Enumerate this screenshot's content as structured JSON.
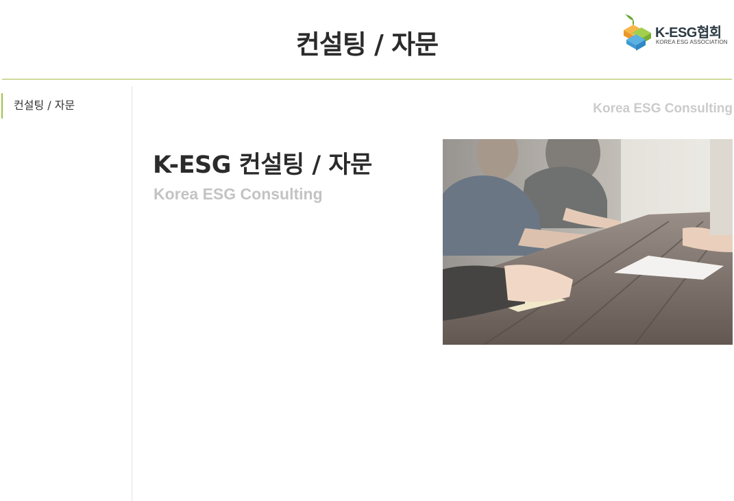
{
  "header": {
    "title": "컨설팅 / 자문",
    "logo": {
      "name": "K-ESG협회",
      "subtitle": "KOREA ESG ASSOCIATION",
      "colors": {
        "orange": "#f0a43a",
        "green": "#8cbf3f",
        "blue": "#3a9bd6",
        "leaf": "#6aa832"
      }
    },
    "accent_line_color": "#a2bb43"
  },
  "sidebar": {
    "items": [
      {
        "label": "컨설팅 / 자문",
        "active": true
      }
    ],
    "active_color": "#9ec24a"
  },
  "main": {
    "caption": "Korea ESG Consulting",
    "title": "K-ESG 컨설팅 / 자문",
    "subtitle": "Korea ESG Consulting",
    "image": {
      "icon": "meeting-photo",
      "subject": "people writing notes at a wooden table"
    }
  }
}
